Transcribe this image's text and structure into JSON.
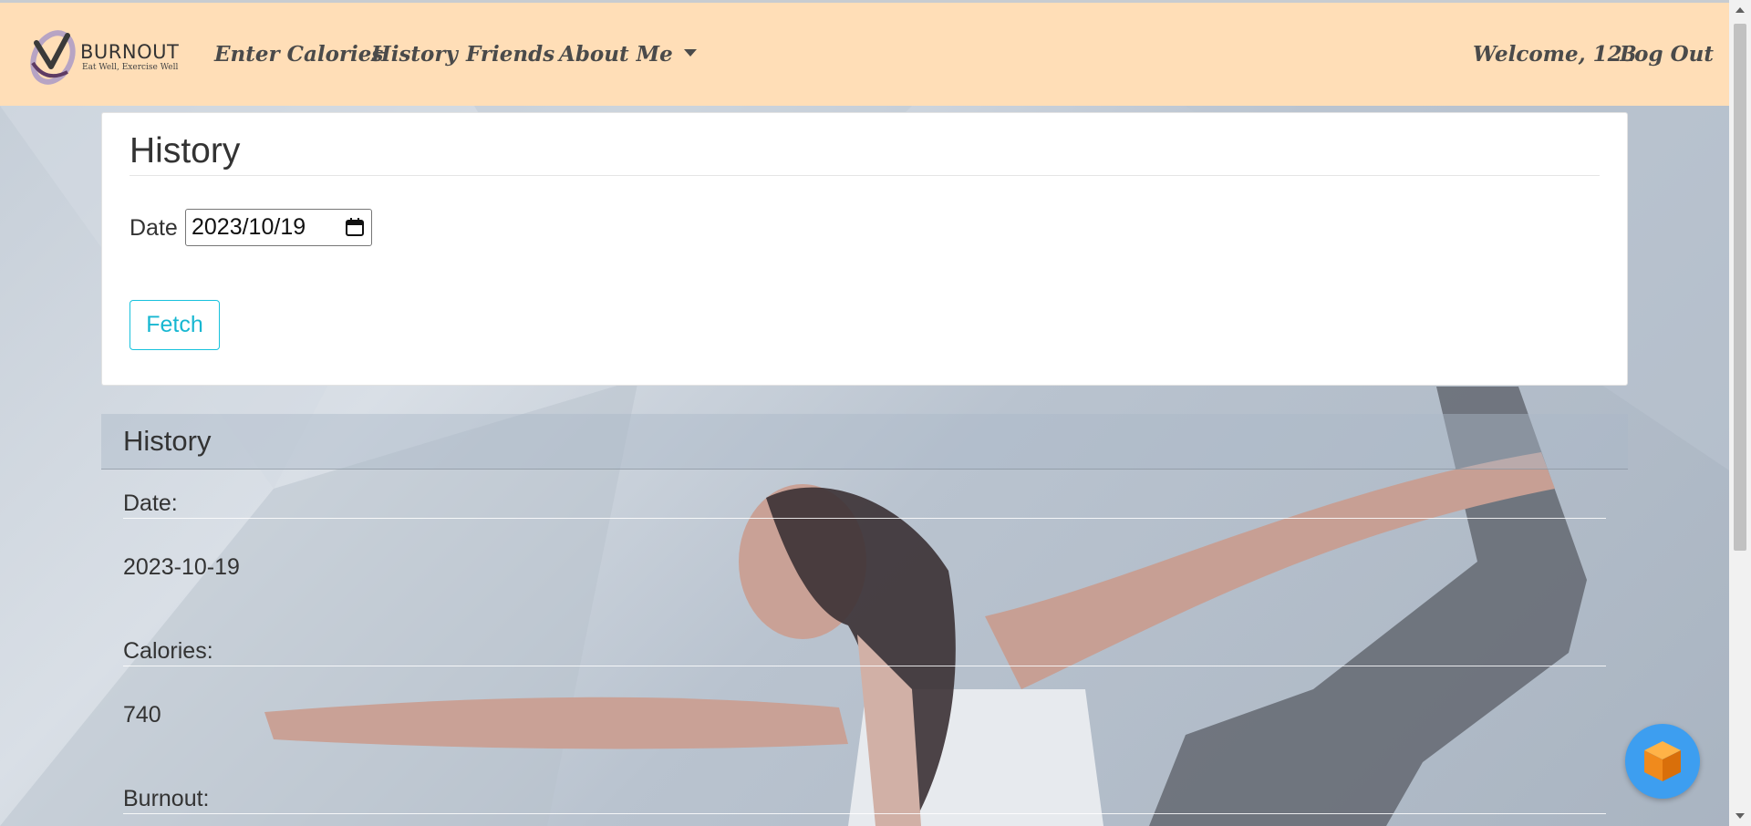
{
  "navbar": {
    "logo": {
      "title": "BURNOUT",
      "tagline": "Eat Well, Exercise Well"
    },
    "links": {
      "enter_calories": "Enter Calories",
      "history": "History",
      "friends": "Friends",
      "about_me": "About Me"
    },
    "welcome": "Welcome, 123",
    "logout": "Log Out"
  },
  "fetch_card": {
    "title": "History",
    "date_label": "Date",
    "date_value": "2023/10/19",
    "fetch_label": "Fetch"
  },
  "history_panel": {
    "title": "History",
    "fields": [
      {
        "label": "Date:",
        "value": "2023-10-19"
      },
      {
        "label": "Calories:",
        "value": "740"
      },
      {
        "label": "Burnout:",
        "value": ""
      }
    ]
  },
  "colors": {
    "navbar_bg": "#ffdeb7",
    "accent": "#17c2dd",
    "chat_bubble": "#3d9ef0"
  },
  "icons": [
    "logo-icon",
    "calendar-icon",
    "chevron-down-icon",
    "chat-cube-icon"
  ]
}
